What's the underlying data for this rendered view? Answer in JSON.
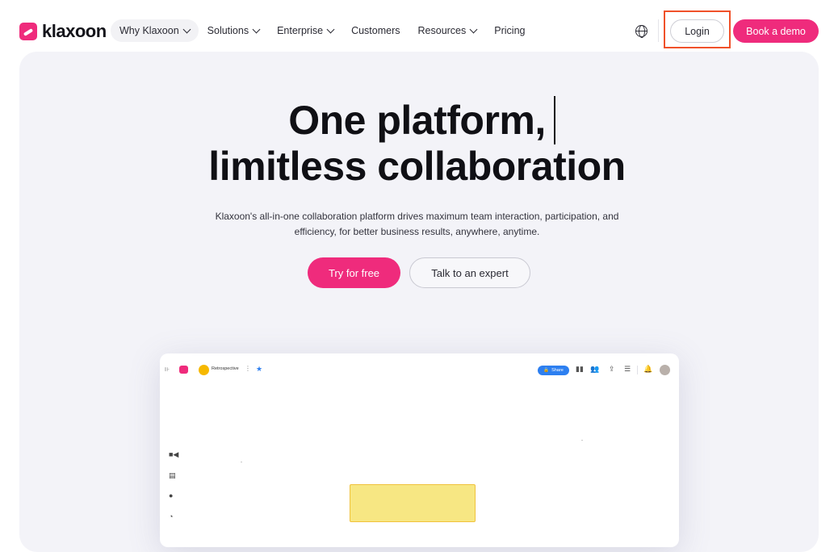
{
  "brand": {
    "name": "klaxoon",
    "logo_icon": "klaxoon-logo-icon",
    "accent": "#ef2b7c"
  },
  "nav": {
    "items": [
      {
        "label": "Why Klaxoon",
        "dropdown": true,
        "active": true
      },
      {
        "label": "Solutions",
        "dropdown": true
      },
      {
        "label": "Enterprise",
        "dropdown": true
      },
      {
        "label": "Customers",
        "dropdown": false
      },
      {
        "label": "Resources",
        "dropdown": true
      },
      {
        "label": "Pricing",
        "dropdown": false
      }
    ],
    "language_icon": "globe-icon",
    "login_label": "Login",
    "demo_label": "Book a demo",
    "highlight_color": "#f0512a"
  },
  "hero": {
    "headline_line1": "One platform,",
    "headline_line2": "limitless collaboration",
    "subcopy_line1": "Klaxoon's all-in-one collaboration platform drives maximum team interaction, participation, and",
    "subcopy_line2": "efficiency, for better business results, anywhere, anytime.",
    "cta_primary": "Try for free",
    "cta_secondary": "Talk to an expert"
  },
  "preview": {
    "board_name": "Retrospective",
    "share_label": "Share",
    "sticky_color": "#f7e783"
  }
}
